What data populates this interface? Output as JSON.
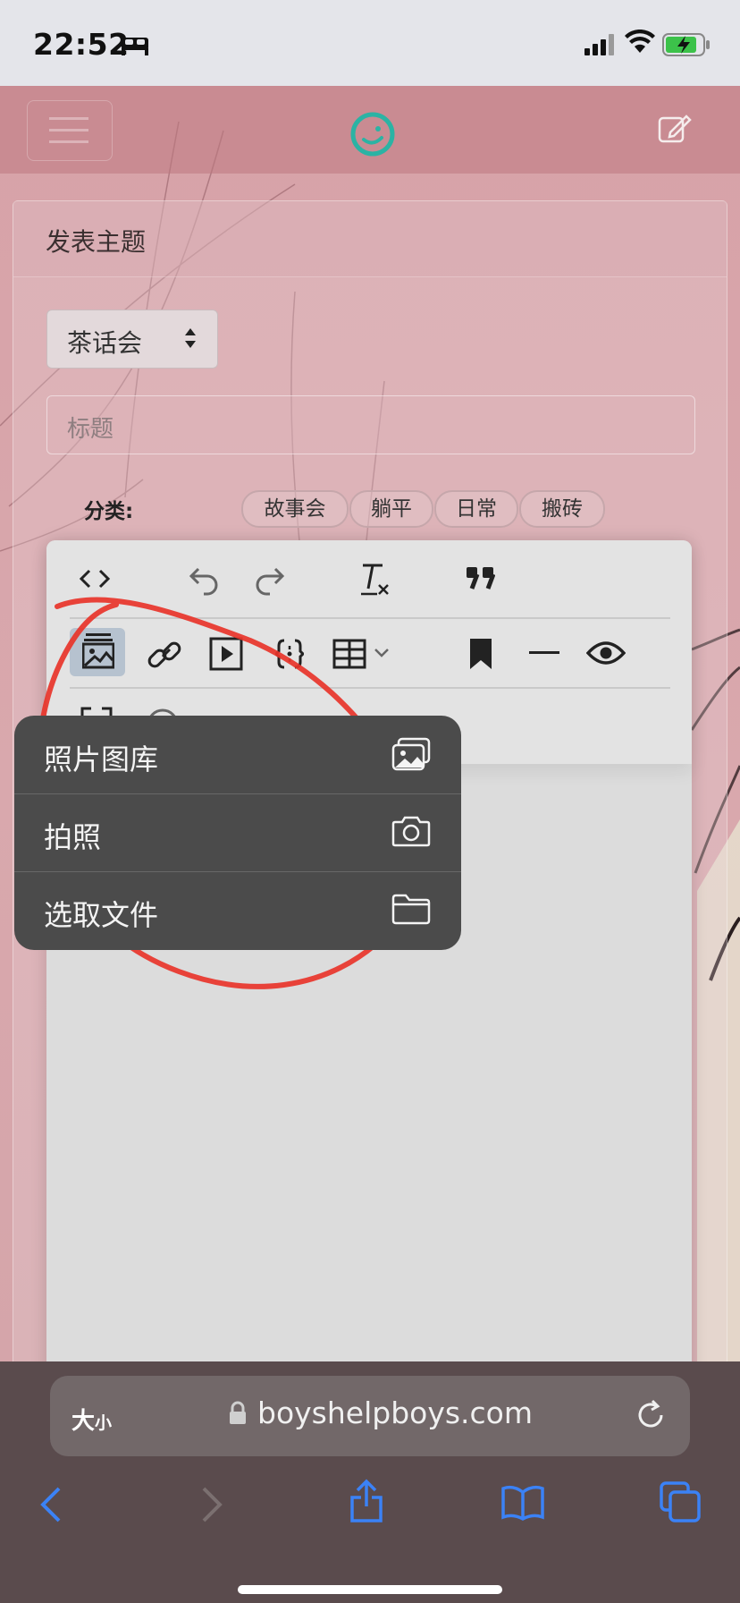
{
  "status": {
    "time": "22:52"
  },
  "page": {
    "card_title": "发表主题",
    "forum_select": "茶话会",
    "title_placeholder": "标题",
    "category_label": "分类:",
    "tags": [
      "故事会",
      "躺平",
      "日常",
      "搬砖"
    ]
  },
  "popup_menu": {
    "items": [
      {
        "label": "照片图库",
        "icon": "photo-library-icon"
      },
      {
        "label": "拍照",
        "icon": "camera-icon"
      },
      {
        "label": "选取文件",
        "icon": "folder-icon"
      }
    ]
  },
  "browser": {
    "text_size": "大",
    "text_size_small": "小",
    "url": "boyshelpboys.com"
  },
  "colors": {
    "accent": "#2bb3a4",
    "annotation": "#e8342a",
    "safari_blue": "#3b82f6"
  }
}
